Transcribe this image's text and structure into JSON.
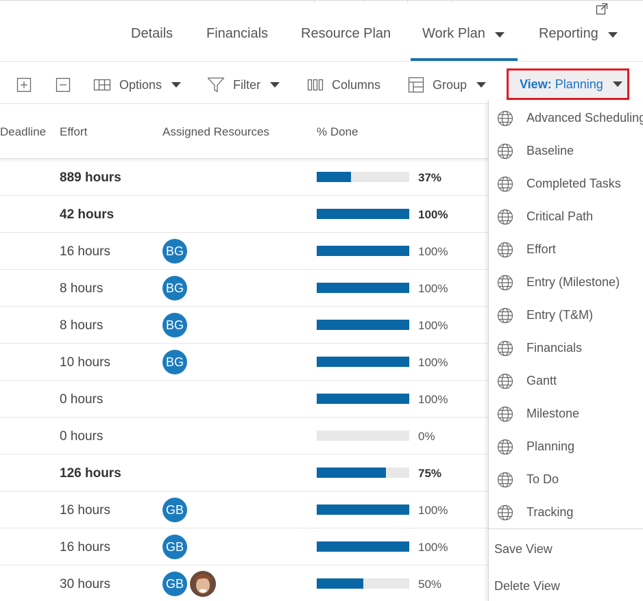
{
  "tabs": [
    {
      "label": "Details",
      "has_caret": false
    },
    {
      "label": "Financials",
      "has_caret": false
    },
    {
      "label": "Resource Plan",
      "has_caret": false
    },
    {
      "label": "Work Plan",
      "has_caret": true,
      "active": true
    },
    {
      "label": "Reporting",
      "has_caret": true
    }
  ],
  "toolbar": {
    "options_label": "Options",
    "filter_label": "Filter",
    "columns_label": "Columns",
    "group_label": "Group",
    "view_key": "View:",
    "view_value": "Planning",
    "highlight_color": "#e01b24"
  },
  "grid": {
    "headers": {
      "deadline": "Deadline",
      "effort": "Effort",
      "assigned": "Assigned Resources",
      "done": "% Done"
    },
    "rows": [
      {
        "effort": "889 hours",
        "pct": "37%",
        "progress": 0.37,
        "bold": true,
        "resources": []
      },
      {
        "effort": "42 hours",
        "pct": "100%",
        "progress": 1.0,
        "bold": true,
        "resources": []
      },
      {
        "effort": "16 hours",
        "pct": "100%",
        "progress": 1.0,
        "bold": false,
        "resources": [
          "BG"
        ]
      },
      {
        "effort": "8 hours",
        "pct": "100%",
        "progress": 1.0,
        "bold": false,
        "resources": [
          "BG"
        ]
      },
      {
        "effort": "8 hours",
        "pct": "100%",
        "progress": 1.0,
        "bold": false,
        "resources": [
          "BG"
        ]
      },
      {
        "effort": "10 hours",
        "pct": "100%",
        "progress": 1.0,
        "bold": false,
        "resources": [
          "BG"
        ]
      },
      {
        "effort": "0 hours",
        "pct": "100%",
        "progress": 1.0,
        "bold": false,
        "resources": []
      },
      {
        "effort": "0 hours",
        "pct": "0%",
        "progress": 0.0,
        "bold": false,
        "resources": []
      },
      {
        "effort": "126 hours",
        "pct": "75%",
        "progress": 0.75,
        "bold": true,
        "resources": []
      },
      {
        "effort": "16 hours",
        "pct": "100%",
        "progress": 1.0,
        "bold": false,
        "resources": [
          "GB"
        ]
      },
      {
        "effort": "16 hours",
        "pct": "100%",
        "progress": 1.0,
        "bold": false,
        "resources": [
          "GB"
        ]
      },
      {
        "effort": "30 hours",
        "pct": "50%",
        "progress": 0.5,
        "bold": false,
        "resources": [
          "GB",
          "photo"
        ]
      }
    ]
  },
  "view_menu": {
    "items": [
      "Advanced Scheduling",
      "Baseline",
      "Completed Tasks",
      "Critical Path",
      "Effort",
      "Entry (Milestone)",
      "Entry (T&M)",
      "Financials",
      "Gantt",
      "Milestone",
      "Planning",
      "To Do",
      "Tracking"
    ],
    "save_label": "Save View",
    "delete_label": "Delete View"
  },
  "colors": {
    "accent": "#1c6ead",
    "progress_fill": "#0a67a6",
    "progress_track": "#e8e8e8",
    "avatar_bg": "#1c7bbd",
    "view_text": "#1a73c7"
  }
}
